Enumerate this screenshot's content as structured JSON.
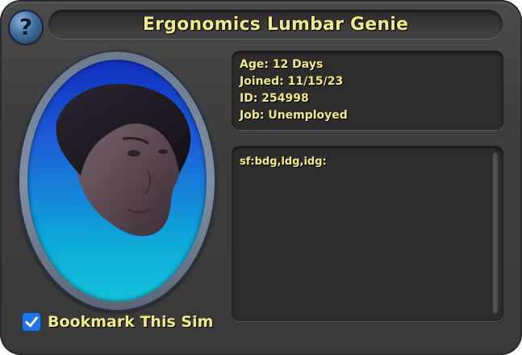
{
  "colors": {
    "text_yellow": "#f3e88a",
    "panel_bg": "#3d3d3d",
    "portrait_blue_top": "#1030c0",
    "portrait_cyan_bottom": "#14c3dc",
    "checkbox_blue": "#1e74e8"
  },
  "help_button": {
    "glyph": "?",
    "icon": "help-icon"
  },
  "title": "Ergonomics Lumbar Genie",
  "info": {
    "age": "Age: 12 Days",
    "joined": "Joined: 11/15/23",
    "id": "ID: 254998",
    "job": "Job: Unemployed"
  },
  "description": "sf:bdg,ldg,idg:",
  "bookmark": {
    "label": "Bookmark This Sim",
    "checked": true
  }
}
